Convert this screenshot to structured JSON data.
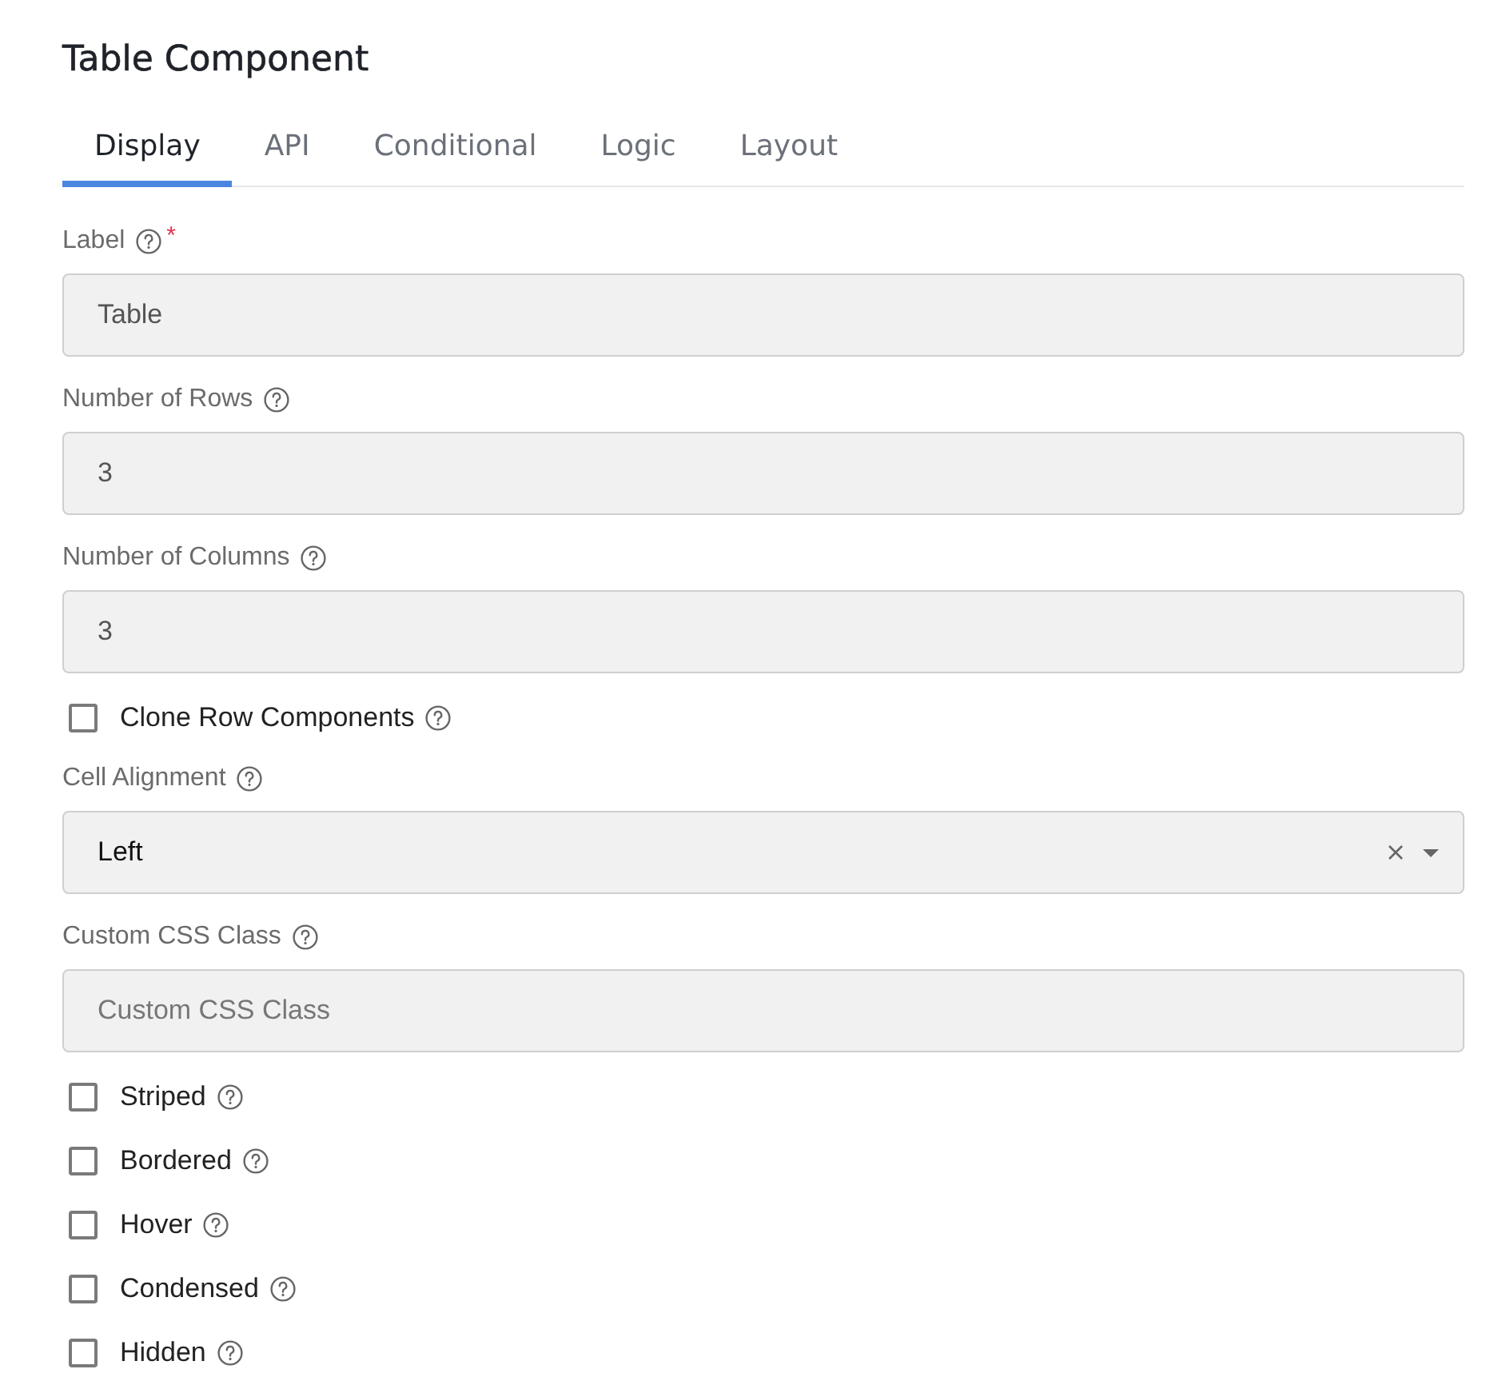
{
  "title": "Table Component",
  "tabs": [
    {
      "label": "Display",
      "selected": true
    },
    {
      "label": "API",
      "selected": false
    },
    {
      "label": "Conditional",
      "selected": false
    },
    {
      "label": "Logic",
      "selected": false
    },
    {
      "label": "Layout",
      "selected": false
    }
  ],
  "fields": [
    {
      "kind": "text",
      "label": "Label",
      "required_mark": "*",
      "value": "Table"
    },
    {
      "kind": "text",
      "label": "Number of Rows",
      "value": "3"
    },
    {
      "kind": "text",
      "label": "Number of Columns",
      "value": "3"
    },
    {
      "kind": "checkbox",
      "label": "Clone Row Components",
      "checked": false
    },
    {
      "kind": "select",
      "label": "Cell Alignment",
      "value": "Left"
    },
    {
      "kind": "text",
      "label": "Custom CSS Class",
      "placeholder": "Custom CSS Class"
    },
    {
      "kind": "checkbox",
      "label": "Striped",
      "checked": false
    },
    {
      "kind": "checkbox",
      "label": "Bordered",
      "checked": false
    },
    {
      "kind": "checkbox",
      "label": "Hover",
      "checked": false
    },
    {
      "kind": "checkbox",
      "label": "Condensed",
      "checked": false
    },
    {
      "kind": "checkbox",
      "label": "Hidden",
      "checked": false
    }
  ]
}
